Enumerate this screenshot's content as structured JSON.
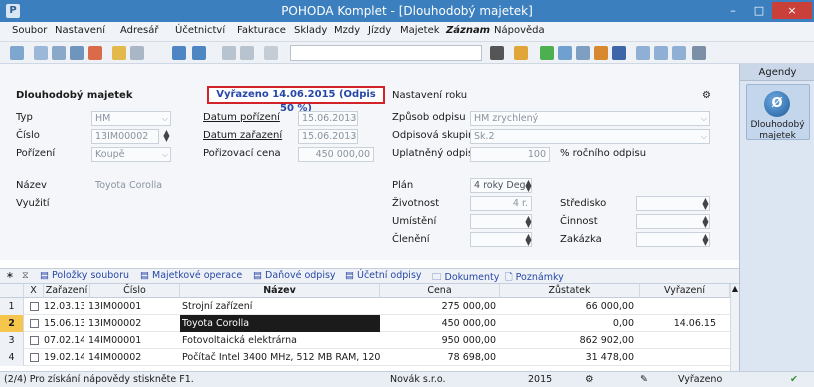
{
  "window": {
    "title": "POHODA Komplet - [Dlouhodobý majetek]",
    "min": "–",
    "max": "□",
    "close": "×"
  },
  "menu": [
    "Soubor",
    "Nastavení",
    "Adresář",
    "Účetnictví",
    "Fakturace",
    "Sklady",
    "Mzdy",
    "Jízdy",
    "Majetek",
    "Záznam",
    "Nápověda"
  ],
  "agenda": {
    "header": "Agendy",
    "item_line1": "Dlouhodobý",
    "item_line2": "majetek"
  },
  "form": {
    "section_title": "Dlouhodobý majetek",
    "highlight": "Vyřazeno 14.06.2015 (Odpis 50 %)",
    "settings_title": "Nastavení roku",
    "labels": {
      "typ": "Typ",
      "cislo": "Číslo",
      "porizeni": "Pořízení",
      "datum_porizeni": "Datum pořízení",
      "datum_zarazeni": "Datum zařazení",
      "porizovaci_cena": "Pořizovací cena",
      "zpusob_odpisu": "Způsob odpisu",
      "odpisova_skupina": "Odpisová skupina",
      "uplatneny_odpis": "Uplatněný odpis",
      "nazev": "Název",
      "vyuziti": "Využití",
      "plan": "Plán",
      "zivotnost": "Životnost",
      "umisteni": "Umístění",
      "cleneni": "Členění",
      "stredisko": "Středisko",
      "cinnost": "Činnost",
      "zakazka": "Zakázka",
      "percent_suffix": "% ročního odpisu"
    },
    "values": {
      "typ": "HM",
      "cislo": "13IM00002",
      "porizeni": "Koupě",
      "datum_porizeni": "15.06.2013",
      "datum_zarazeni": "15.06.2013",
      "porizovaci_cena": "450 000,00",
      "zpusob_odpisu": "HM zrychlený",
      "odpisova_skupina": "Sk.2",
      "uplatneny_odpis": "100",
      "nazev": "Toyota Corolla",
      "plan": "4 roky Deg",
      "zivotnost": "4 r."
    }
  },
  "tabs": [
    "Položky souboru",
    "Majetkové operace",
    "Daňové odpisy",
    "Účetní odpisy",
    "Dokumenty",
    "Poznámky"
  ],
  "table": {
    "headers": [
      "X",
      "Zařazení",
      "Číslo",
      "Název",
      "Cena",
      "Zůstatek",
      "Vyřazení"
    ],
    "rows": [
      {
        "n": "1",
        "zarazeni": "12.03.13",
        "cislo": "13IM00001",
        "nazev": "Strojní zařízení",
        "cena": "275 000,00",
        "zustatek": "66 000,00",
        "vyrazeni": ""
      },
      {
        "n": "2",
        "zarazeni": "15.06.13",
        "cislo": "13IM00002",
        "nazev": "Toyota Corolla",
        "cena": "450 000,00",
        "zustatek": "0,00",
        "vyrazeni": "14.06.15"
      },
      {
        "n": "3",
        "zarazeni": "07.02.14",
        "cislo": "14IM00001",
        "nazev": "Fotovoltaická elektrárna",
        "cena": "950 000,00",
        "zustatek": "862 902,00",
        "vyrazeni": ""
      },
      {
        "n": "4",
        "zarazeni": "19.02.14",
        "cislo": "14IM00002",
        "nazev": "Počítač Intel 3400 MHz, 512 MB RAM, 120 GB H",
        "cena": "78 698,00",
        "zustatek": "31 478,00",
        "vyrazeni": ""
      }
    ]
  },
  "status": {
    "help": "(2/4) Pro získání nápovědy stiskněte F1.",
    "company": "Novák s.r.o.",
    "year": "2015",
    "state": "Vyřazeno"
  },
  "colors": {
    "titlebar": "#3b7fbf",
    "highlight_border": "#d3232a",
    "highlight_text": "#2747a8",
    "selected_row": "#1b1b1b"
  }
}
